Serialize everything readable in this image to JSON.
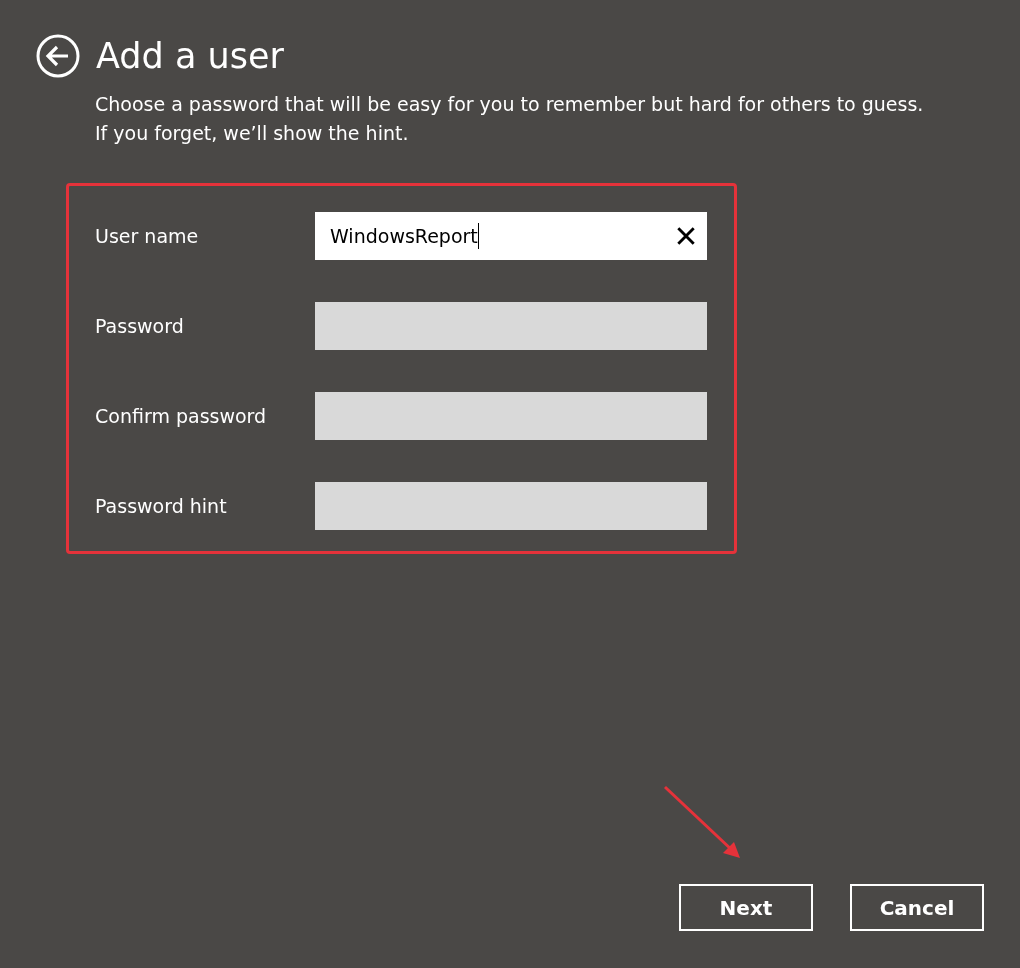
{
  "title": "Add a user",
  "description": [
    "Choose a password that will be easy for you to remember but hard for others to guess.",
    "If you forget, we’ll show the hint."
  ],
  "fields": [
    {
      "label": "User name",
      "value": "WindowsReport",
      "focused": true
    },
    {
      "label": "Password",
      "focused": false
    },
    {
      "label": "Confirm password",
      "focused": false
    },
    {
      "label": "Password hint",
      "focused": false
    }
  ],
  "buttons": [
    {
      "label": "Next"
    },
    {
      "label": "Cancel"
    }
  ]
}
